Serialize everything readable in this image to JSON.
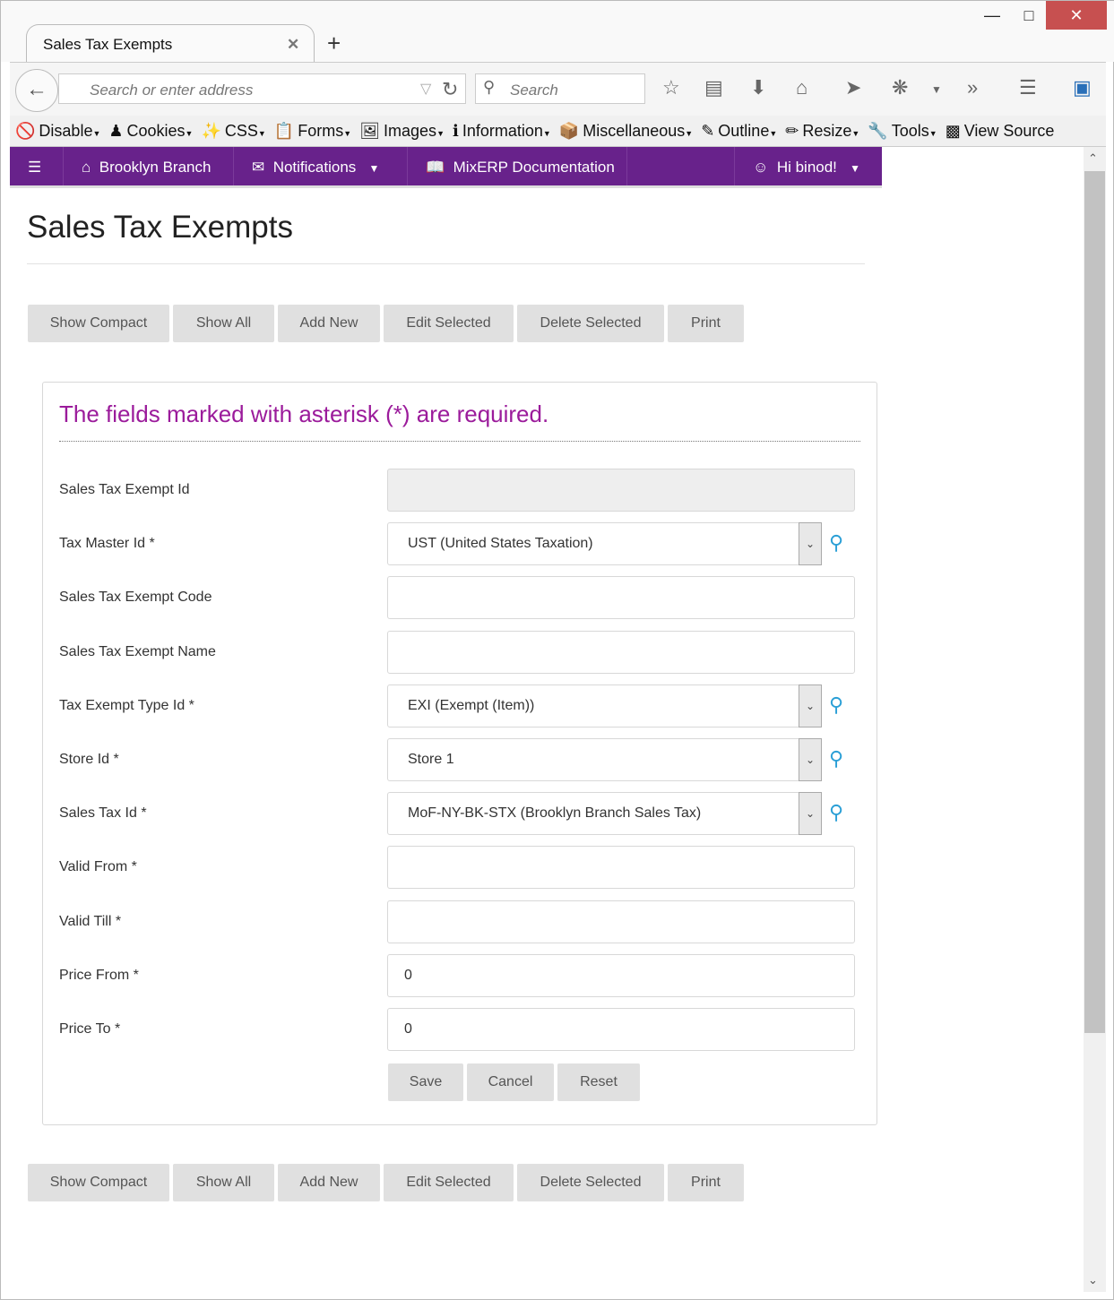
{
  "browser": {
    "tab_title": "Sales Tax Exempts",
    "address_placeholder": "Search or enter address",
    "search_placeholder": "Search",
    "bookmarks": [
      "Disable",
      "Cookies",
      "CSS",
      "Forms",
      "Images",
      "Information",
      "Miscellaneous",
      "Outline",
      "Resize",
      "Tools",
      "View Source"
    ]
  },
  "nav": {
    "branch": "Brooklyn Branch",
    "notifications": "Notifications",
    "docs": "MixERP Documentation",
    "user": "Hi binod!"
  },
  "page": {
    "title": "Sales Tax Exempts",
    "required_note": "The fields marked with asterisk (*) are required."
  },
  "toolbar": [
    "Show Compact",
    "Show All",
    "Add New",
    "Edit Selected",
    "Delete Selected",
    "Print"
  ],
  "fields": [
    {
      "label": "Sales Tax Exempt Id",
      "value": "",
      "type": "readonly"
    },
    {
      "label": "Tax Master Id *",
      "value": "UST (United States Taxation)",
      "type": "select"
    },
    {
      "label": "Sales Tax Exempt Code",
      "value": "",
      "type": "text"
    },
    {
      "label": "Sales Tax Exempt Name",
      "value": "",
      "type": "text"
    },
    {
      "label": "Tax Exempt Type Id *",
      "value": "EXI (Exempt (Item))",
      "type": "select"
    },
    {
      "label": "Store Id *",
      "value": "Store 1",
      "type": "select"
    },
    {
      "label": "Sales Tax Id *",
      "value": "MoF-NY-BK-STX (Brooklyn Branch Sales Tax)",
      "type": "select"
    },
    {
      "label": "Valid From *",
      "value": "",
      "type": "text"
    },
    {
      "label": "Valid Till *",
      "value": "",
      "type": "text"
    },
    {
      "label": "Price From *",
      "value": "0",
      "type": "text"
    },
    {
      "label": "Price To *",
      "value": "0",
      "type": "text"
    }
  ],
  "form_buttons": [
    "Save",
    "Cancel",
    "Reset"
  ],
  "colors": {
    "nav": "#68228b",
    "accent": "#9b1b9b"
  }
}
